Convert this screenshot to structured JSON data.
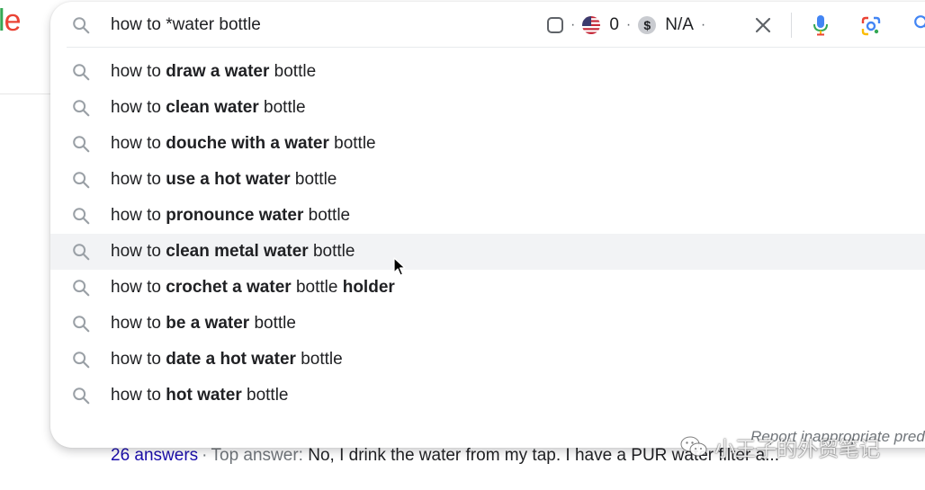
{
  "logo_fragment": "le",
  "search": {
    "query": "how to *water bottle"
  },
  "extension": {
    "count": "0",
    "dollar_symbol": "$",
    "value": "N/A",
    "dot": "·"
  },
  "suggestions": [
    {
      "prefix": "how to ",
      "bold": "draw a water",
      "suffix": " bottle",
      "bold2": ""
    },
    {
      "prefix": "how to ",
      "bold": "clean water",
      "suffix": " bottle",
      "bold2": ""
    },
    {
      "prefix": "how to ",
      "bold": "douche with a water",
      "suffix": " bottle",
      "bold2": ""
    },
    {
      "prefix": "how to ",
      "bold": "use a hot water",
      "suffix": " bottle",
      "bold2": ""
    },
    {
      "prefix": "how to ",
      "bold": "pronounce water",
      "suffix": " bottle",
      "bold2": ""
    },
    {
      "prefix": "how to ",
      "bold": "clean metal water",
      "suffix": " bottle",
      "bold2": ""
    },
    {
      "prefix": "how to ",
      "bold": "crochet a water",
      "suffix": " bottle ",
      "bold2": "holder"
    },
    {
      "prefix": "how to ",
      "bold": "be a water",
      "suffix": " bottle",
      "bold2": ""
    },
    {
      "prefix": "how to ",
      "bold": "date a hot water",
      "suffix": " bottle",
      "bold2": ""
    },
    {
      "prefix": "how to ",
      "bold": "hot water",
      "suffix": " bottle",
      "bold2": ""
    }
  ],
  "hovered_index": 5,
  "report_link": "Report inappropriate predictions",
  "result": {
    "answers": "26 answers",
    "separator": "·",
    "top_answer_label": "Top answer:",
    "top_answer_text": " No, I drink the water from my tap. I have a PUR water filter a..."
  },
  "watermark": "小王子的外贸笔记",
  "colors": {
    "link_blue": "#1a0dab",
    "text": "#202124",
    "muted": "#70757a",
    "logo_green": "#34A853",
    "logo_red": "#EA4335"
  }
}
